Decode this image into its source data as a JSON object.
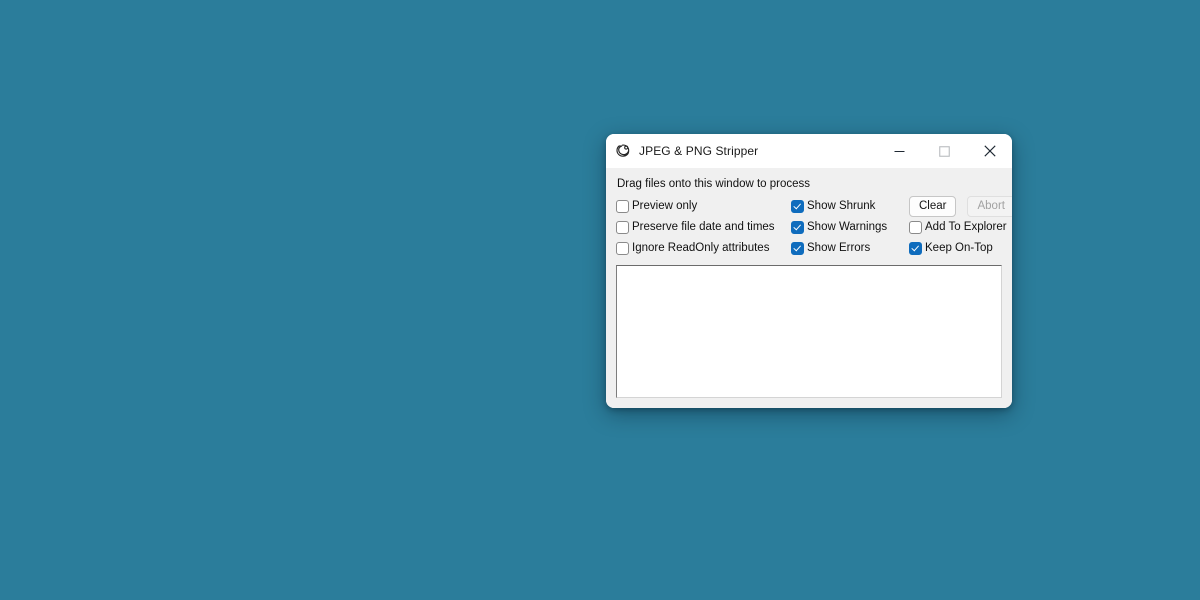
{
  "desktop": {
    "background_color": "#2b7d9b"
  },
  "window": {
    "title": "JPEG & PNG Stripper",
    "icon": "app-swirl-icon",
    "accent_color": "#0f6cbd",
    "titlebar_color": "#ffffff",
    "client_color": "#f0f0f0",
    "controls": {
      "minimize": "minimize-icon",
      "maximize": "maximize-icon",
      "close": "close-icon"
    }
  },
  "client": {
    "drag_hint": "Drag files onto this window to process",
    "options": [
      {
        "label": "Preview only",
        "checked": false
      },
      {
        "label": "Preserve file date and times",
        "checked": false
      },
      {
        "label": "Ignore ReadOnly attributes",
        "checked": false
      },
      {
        "label": "Show Shrunk",
        "checked": true
      },
      {
        "label": "Show Warnings",
        "checked": true
      },
      {
        "label": "Show Errors",
        "checked": true
      },
      {
        "label": "Add To Explorer",
        "checked": false
      },
      {
        "label": "Keep On-Top",
        "checked": true
      }
    ],
    "buttons": [
      {
        "label": "Clear",
        "enabled": true
      },
      {
        "label": "Abort",
        "enabled": false
      }
    ],
    "log_output": {
      "text": "",
      "placeholder": ""
    }
  }
}
